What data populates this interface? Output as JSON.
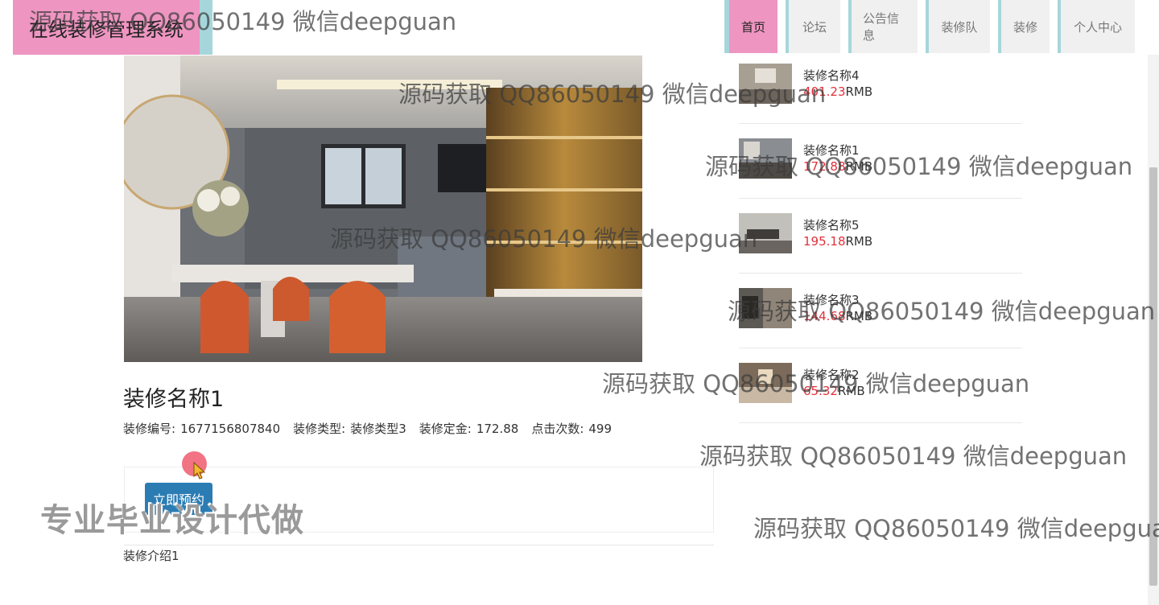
{
  "header": {
    "title": "在线装修管理系统",
    "nav": [
      "首页",
      "论坛",
      "公告信息",
      "装修队",
      "装修",
      "个人中心"
    ],
    "active_index": 0
  },
  "product": {
    "title": "装修名称1",
    "meta": [
      {
        "label": "装修编号:",
        "value": "1677156807840"
      },
      {
        "label": "装修类型:",
        "value": "装修类型3"
      },
      {
        "label": "装修定金:",
        "value": "172.88"
      },
      {
        "label": "点击次数:",
        "value": "499"
      }
    ],
    "book_button": "立即预约",
    "intro": "装修介绍1"
  },
  "sidebar": {
    "items": [
      {
        "name": "装修名称4",
        "price": "401.23",
        "unit": "RMB"
      },
      {
        "name": "装修名称1",
        "price": "172.88",
        "unit": "RMB"
      },
      {
        "name": "装修名称5",
        "price": "195.18",
        "unit": "RMB"
      },
      {
        "name": "装修名称3",
        "price": "144.68",
        "unit": "RMB"
      },
      {
        "name": "装修名称2",
        "price": "65.32",
        "unit": "RMB"
      }
    ]
  },
  "overlay": {
    "watermark": "源码获取 QQ86050149 微信deepguan",
    "banner": "专业毕业设计代做"
  },
  "colors": {
    "brand_pink": "#ee95c1",
    "brand_teal": "#a6d6db",
    "price_red": "#e0303a",
    "button_blue": "#2b7cb3"
  }
}
